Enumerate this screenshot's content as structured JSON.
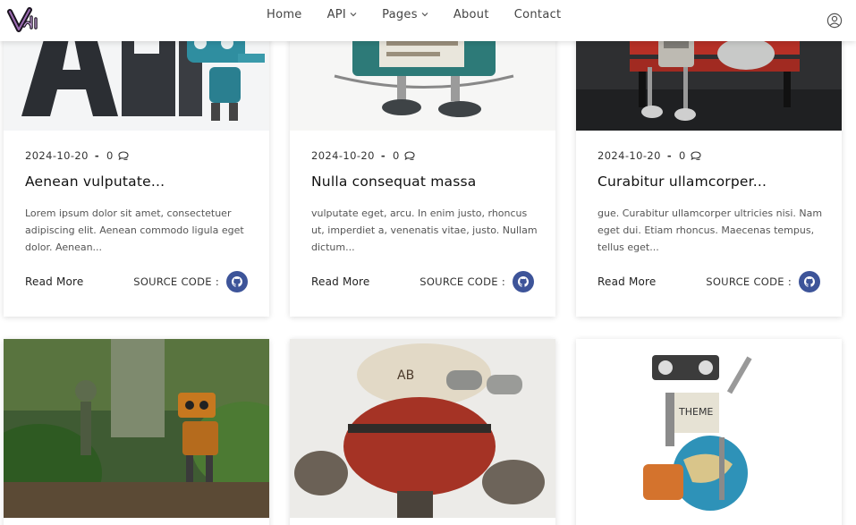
{
  "header": {
    "logo_text": "Vati",
    "nav": [
      {
        "label": "Home",
        "has_dropdown": false
      },
      {
        "label": "API",
        "has_dropdown": true
      },
      {
        "label": "Pages",
        "has_dropdown": true
      },
      {
        "label": "About",
        "has_dropdown": false
      },
      {
        "label": "Contact",
        "has_dropdown": false
      }
    ],
    "user_icon": "user-circle-icon"
  },
  "cards": [
    {
      "date": "2024-10-20",
      "separator": "-",
      "comments": "0",
      "title": "Aenean vulputate...",
      "excerpt": "Lorem ipsum dolor sit amet, consectetuer adipiscing elit. Aenean commodo ligula eget dolor. Aenean...",
      "read_more": "Read More",
      "source_label": "SOURCE CODE :",
      "image": "robot-with-api-letters"
    },
    {
      "date": "2024-10-20",
      "separator": "-",
      "comments": "0",
      "title": "Nulla consequat massa",
      "excerpt": "vulputate eget, arcu. In enim justo, rhoncus ut, imperdiet a, venenatis vitae, justo. Nullam dictum...",
      "read_more": "Read More",
      "source_label": "SOURCE CODE :",
      "image": "tin-robot-toy"
    },
    {
      "date": "2024-10-20",
      "separator": "-",
      "comments": "0",
      "title": "Curabitur ullamcorper...",
      "excerpt": "gue. Curabitur ullamcorper ultricies nisi. Nam eget dui. Etiam rhoncus. Maecenas tempus, tellus eget...",
      "read_more": "Read More",
      "source_label": "SOURCE CODE :",
      "image": "robots-on-red-bench"
    },
    {
      "image": "robots-in-garden"
    },
    {
      "image": "rusty-red-robot"
    },
    {
      "image": "scrap-robot-with-globe"
    }
  ],
  "colors": {
    "accent": "#3d5499",
    "text": "#222222",
    "muted": "#555555"
  }
}
